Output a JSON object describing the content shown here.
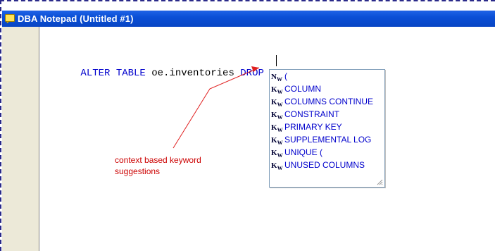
{
  "window": {
    "title": "DBA Notepad  (Untitled #1)",
    "icon": "note-icon"
  },
  "editor": {
    "code_tokens": [
      {
        "text": "ALTER TABLE",
        "kind": "keyword"
      },
      {
        "text": " oe.inventories ",
        "kind": "identifier"
      },
      {
        "text": "DROP",
        "kind": "keyword"
      },
      {
        "text": " ",
        "kind": "identifier"
      }
    ]
  },
  "autocomplete": {
    "items": [
      {
        "badge": "N",
        "label": "("
      },
      {
        "badge": "K",
        "label": "COLUMN"
      },
      {
        "badge": "K",
        "label": "COLUMNS CONTINUE"
      },
      {
        "badge": "K",
        "label": "CONSTRAINT"
      },
      {
        "badge": "K",
        "label": "PRIMARY KEY"
      },
      {
        "badge": "K",
        "label": "SUPPLEMENTAL LOG"
      },
      {
        "badge": "K",
        "label": "UNIQUE ("
      },
      {
        "badge": "K",
        "label": "UNUSED COLUMNS"
      }
    ],
    "badge_sub": "W"
  },
  "annotation": {
    "line1": "context based keyword",
    "line2": "suggestions",
    "color": "#cc0000"
  },
  "colors": {
    "keyword": "#0000cc",
    "titlebar": "#0a4fd6",
    "gutter": "#ece9d8"
  }
}
